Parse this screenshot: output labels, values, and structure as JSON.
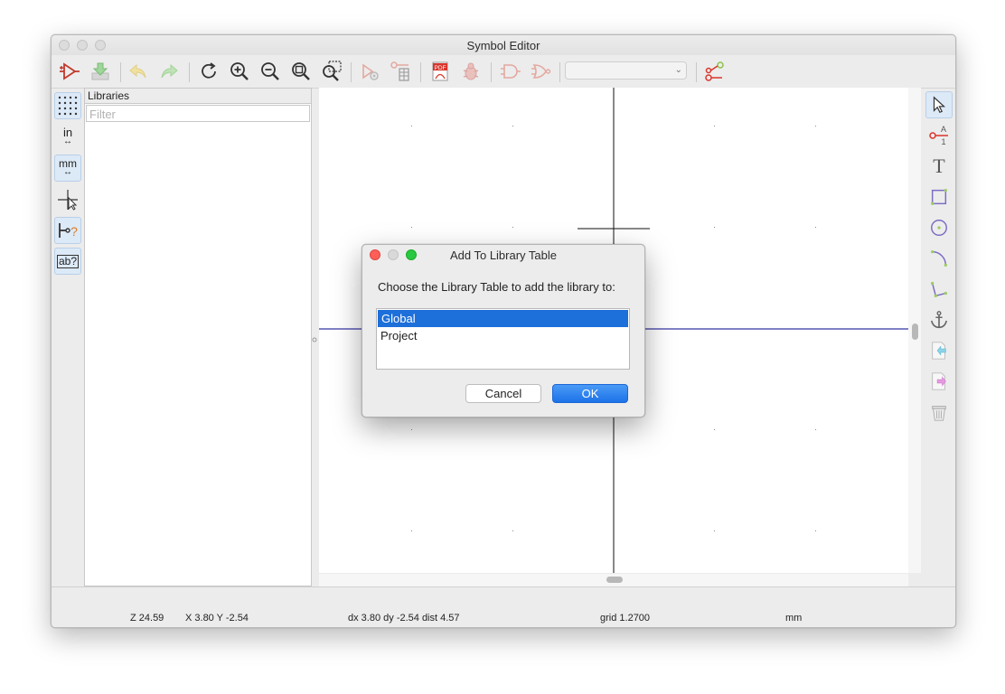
{
  "window": {
    "title": "Symbol Editor"
  },
  "toolbar": {
    "icons": [
      "new-symbol-icon",
      "save-icon",
      "undo-icon",
      "redo-icon",
      "refresh-icon",
      "zoom-in-icon",
      "zoom-out-icon",
      "zoom-fit-icon",
      "zoom-selection-icon",
      "symbol-properties-icon",
      "pin-table-icon",
      "export-pdf-icon",
      "bug-check-icon",
      "body-style-icon",
      "de-morgan-icon",
      "unit-select-icon",
      "component-from-schematic-icon"
    ],
    "pdf_label": "PDF",
    "unit_select_value": ""
  },
  "left_toolbar": {
    "in_label": "in",
    "mm_label": "mm",
    "pin_label": "?",
    "text_label": "ab?"
  },
  "libraries": {
    "header": "Libraries",
    "filter_placeholder": "Filter"
  },
  "right_toolbar": {
    "pin_num": "1",
    "pin_letter": "A",
    "text_tool": "T"
  },
  "status": {
    "zoom": "Z 24.59",
    "coords": "X 3.80  Y -2.54",
    "delta": "dx 3.80  dy -2.54  dist 4.57",
    "grid": "grid 1.2700",
    "units": "mm"
  },
  "dialog": {
    "title": "Add To Library Table",
    "prompt": "Choose the Library Table to add the library to:",
    "options": [
      "Global",
      "Project"
    ],
    "selected": "Global",
    "cancel": "Cancel",
    "ok": "OK"
  },
  "colors": {
    "selection": "#1d6fd9",
    "ok_button": "#1d72e8",
    "axis": "#00008b",
    "accent_red": "#d9352b"
  }
}
